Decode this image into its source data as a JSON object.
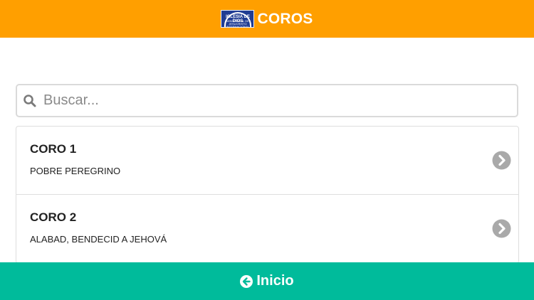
{
  "header": {
    "title": "COROS",
    "logo": {
      "line1": "IGLESIA DE DIOS",
      "line2": "MINISTERIAL DE JESUCRISTO INTERNACIONAL",
      "icon": "church-logo"
    }
  },
  "search": {
    "placeholder": "Buscar...",
    "value": "",
    "icon": "search-icon"
  },
  "list": {
    "items": [
      {
        "title": "CORO 1",
        "subtitle": "POBRE PEREGRINO",
        "icon": "chevron-right-circle-icon"
      },
      {
        "title": "CORO 2",
        "subtitle": "ALABAD, BENDECID A JEHOVÁ",
        "icon": "chevron-right-circle-icon"
      }
    ]
  },
  "footer": {
    "label": "Inicio",
    "icon": "arrow-left-circle-icon"
  },
  "colors": {
    "header": "#ff9f00",
    "footer": "#00bb9b",
    "chevron": "#a9a9a9"
  }
}
